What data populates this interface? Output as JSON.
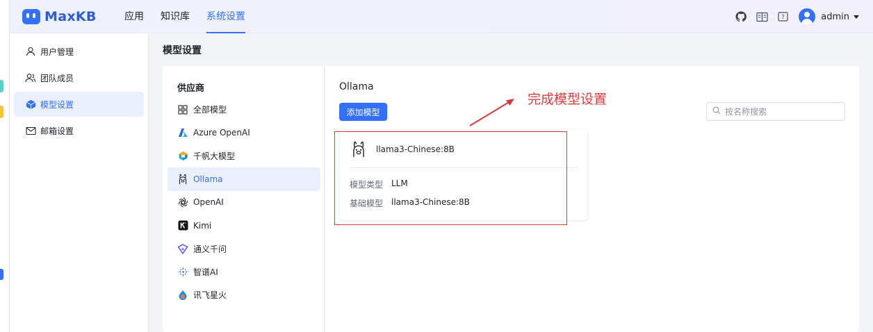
{
  "app": {
    "logo_text": "MaxKB",
    "brand_color": "#3370ff"
  },
  "topnav": {
    "items": [
      {
        "label": "应用",
        "active": false
      },
      {
        "label": "知识库",
        "active": false
      },
      {
        "label": "系统设置",
        "active": true
      }
    ]
  },
  "header_right": {
    "icons": [
      "github-icon",
      "book-icon",
      "help-icon"
    ],
    "user_name": "admin"
  },
  "sidebar": {
    "items": [
      {
        "label": "用户管理",
        "icon": "user-icon",
        "active": false
      },
      {
        "label": "团队成员",
        "icon": "team-icon",
        "active": false
      },
      {
        "label": "模型设置",
        "icon": "cube-icon",
        "active": true
      },
      {
        "label": "邮箱设置",
        "icon": "mail-icon",
        "active": false
      }
    ]
  },
  "page": {
    "title": "模型设置"
  },
  "providers": {
    "heading": "供应商",
    "items": [
      {
        "label": "全部模型",
        "icon": "grid-icon",
        "active": false
      },
      {
        "label": "Azure OpenAI",
        "icon": "azure-icon",
        "active": false
      },
      {
        "label": "千帆大模型",
        "icon": "qianfan-icon",
        "active": false
      },
      {
        "label": "Ollama",
        "icon": "llama-icon",
        "active": true
      },
      {
        "label": "OpenAI",
        "icon": "openai-icon",
        "active": false
      },
      {
        "label": "Kimi",
        "icon": "kimi-icon",
        "active": false
      },
      {
        "label": "通义千问",
        "icon": "tongyi-icon",
        "active": false
      },
      {
        "label": "智谱AI",
        "icon": "zhipu-icon",
        "active": false
      },
      {
        "label": "讯飞星火",
        "icon": "xunfei-icon",
        "active": false
      }
    ]
  },
  "content": {
    "title": "Ollama",
    "add_button": "添加模型",
    "search_placeholder": "按名称搜索",
    "search_value": ""
  },
  "model_card": {
    "name": "llama3-Chinese:8B",
    "icon": "llama-icon",
    "rows": [
      {
        "key": "模型类型",
        "value": "LLM"
      },
      {
        "key": "基础模型",
        "value": "llama3-Chinese:8B"
      }
    ]
  },
  "annotation": {
    "text": "完成模型设置",
    "color": "#e03c3c"
  }
}
